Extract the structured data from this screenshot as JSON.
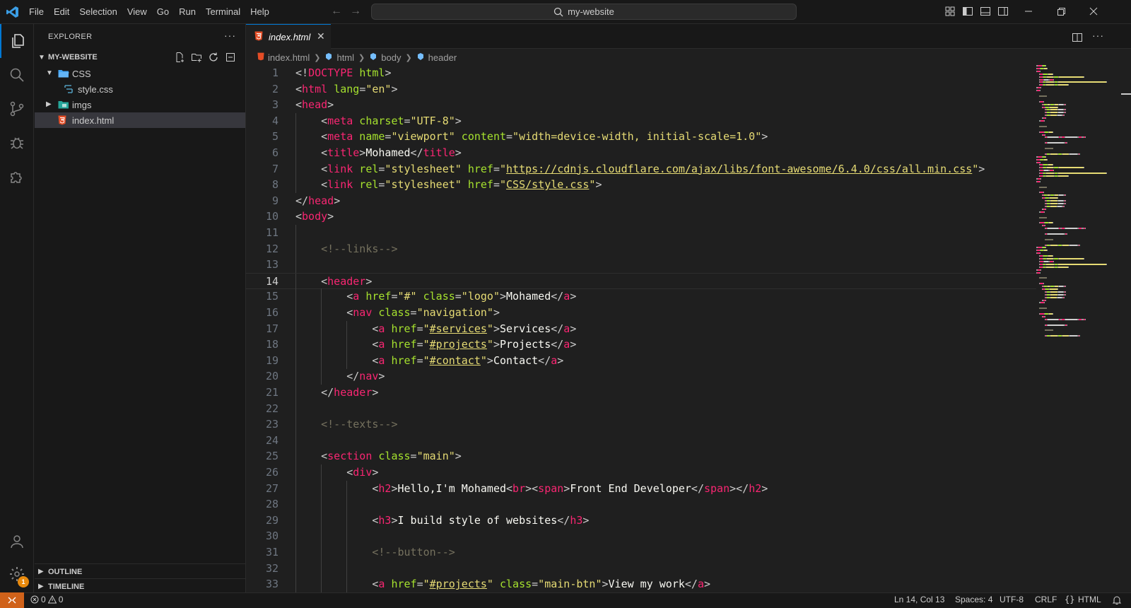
{
  "menu": [
    "File",
    "Edit",
    "Selection",
    "View",
    "Go",
    "Run",
    "Terminal",
    "Help"
  ],
  "search": {
    "text": "my-website"
  },
  "sidebar": {
    "title": "EXPLORER",
    "folder": "MY-WEBSITE",
    "tree": [
      {
        "label": "CSS",
        "kind": "folder-open",
        "depth": 1
      },
      {
        "label": "style.css",
        "kind": "css-file",
        "depth": 2
      },
      {
        "label": "imgs",
        "kind": "folder-closed",
        "depth": 1
      },
      {
        "label": "index.html",
        "kind": "html-file",
        "depth": 1,
        "selected": true
      }
    ],
    "sections": {
      "outline": "OUTLINE",
      "timeline": "TIMELINE"
    }
  },
  "editor": {
    "tab": "index.html",
    "breadcrumb": [
      "index.html",
      "html",
      "body",
      "header"
    ],
    "current_line": 14,
    "lines": [
      {
        "n": "1",
        "ind": 0,
        "toks": [
          [
            "p",
            "<!"
          ],
          [
            "t",
            "DOCTYPE"
          ],
          [
            "p",
            " "
          ],
          [
            "a",
            "html"
          ],
          [
            "p",
            ">"
          ]
        ]
      },
      {
        "n": "2",
        "ind": 0,
        "toks": [
          [
            "p",
            "<"
          ],
          [
            "t",
            "html"
          ],
          [
            "p",
            " "
          ],
          [
            "a",
            "lang"
          ],
          [
            "p",
            "="
          ],
          [
            "s",
            "\"en\""
          ],
          [
            "p",
            ">"
          ]
        ]
      },
      {
        "n": "3",
        "ind": 0,
        "toks": [
          [
            "p",
            "<"
          ],
          [
            "t",
            "head"
          ],
          [
            "p",
            ">"
          ]
        ]
      },
      {
        "n": "4",
        "ind": 1,
        "toks": [
          [
            "p",
            "<"
          ],
          [
            "t",
            "meta"
          ],
          [
            "p",
            " "
          ],
          [
            "a",
            "charset"
          ],
          [
            "p",
            "="
          ],
          [
            "s",
            "\"UTF-8\""
          ],
          [
            "p",
            ">"
          ]
        ]
      },
      {
        "n": "5",
        "ind": 1,
        "toks": [
          [
            "p",
            "<"
          ],
          [
            "t",
            "meta"
          ],
          [
            "p",
            " "
          ],
          [
            "a",
            "name"
          ],
          [
            "p",
            "="
          ],
          [
            "s",
            "\"viewport\""
          ],
          [
            "p",
            " "
          ],
          [
            "a",
            "content"
          ],
          [
            "p",
            "="
          ],
          [
            "s",
            "\"width=device-width, initial-scale=1.0\""
          ],
          [
            "p",
            ">"
          ]
        ]
      },
      {
        "n": "6",
        "ind": 1,
        "toks": [
          [
            "p",
            "<"
          ],
          [
            "t",
            "title"
          ],
          [
            "p",
            ">"
          ],
          [
            "x",
            "Mohamed"
          ],
          [
            "p",
            "</"
          ],
          [
            "t",
            "title"
          ],
          [
            "p",
            ">"
          ]
        ]
      },
      {
        "n": "7",
        "ind": 1,
        "toks": [
          [
            "p",
            "<"
          ],
          [
            "t",
            "link"
          ],
          [
            "p",
            " "
          ],
          [
            "a",
            "rel"
          ],
          [
            "p",
            "="
          ],
          [
            "s",
            "\"stylesheet\""
          ],
          [
            "p",
            " "
          ],
          [
            "a",
            "href"
          ],
          [
            "p",
            "="
          ],
          [
            "s",
            "\""
          ],
          [
            "u",
            "https://cdnjs.cloudflare.com/ajax/libs/font-awesome/6.4.0/css/all.min.css"
          ],
          [
            "s",
            "\""
          ],
          [
            "p",
            ">"
          ]
        ]
      },
      {
        "n": "8",
        "ind": 1,
        "toks": [
          [
            "p",
            "<"
          ],
          [
            "t",
            "link"
          ],
          [
            "p",
            " "
          ],
          [
            "a",
            "rel"
          ],
          [
            "p",
            "="
          ],
          [
            "s",
            "\"stylesheet\""
          ],
          [
            "p",
            " "
          ],
          [
            "a",
            "href"
          ],
          [
            "p",
            "="
          ],
          [
            "s",
            "\""
          ],
          [
            "u",
            "CSS/style.css"
          ],
          [
            "s",
            "\""
          ],
          [
            "p",
            ">"
          ]
        ]
      },
      {
        "n": "9",
        "ind": 0,
        "toks": [
          [
            "p",
            "</"
          ],
          [
            "t",
            "head"
          ],
          [
            "p",
            ">"
          ]
        ]
      },
      {
        "n": "10",
        "ind": 0,
        "toks": [
          [
            "p",
            "<"
          ],
          [
            "t",
            "body"
          ],
          [
            "p",
            ">"
          ]
        ]
      },
      {
        "n": "11",
        "ind": 1,
        "toks": []
      },
      {
        "n": "12",
        "ind": 1,
        "toks": [
          [
            "c",
            "<!--links-->"
          ]
        ]
      },
      {
        "n": "13",
        "ind": 1,
        "toks": []
      },
      {
        "n": "14",
        "ind": 1,
        "toks": [
          [
            "p",
            "<"
          ],
          [
            "t",
            "header"
          ],
          [
            "p",
            ">"
          ]
        ]
      },
      {
        "n": "15",
        "ind": 2,
        "toks": [
          [
            "p",
            "<"
          ],
          [
            "t",
            "a"
          ],
          [
            "p",
            " "
          ],
          [
            "a",
            "href"
          ],
          [
            "p",
            "="
          ],
          [
            "s",
            "\"#\""
          ],
          [
            "p",
            " "
          ],
          [
            "a",
            "class"
          ],
          [
            "p",
            "="
          ],
          [
            "s",
            "\"logo\""
          ],
          [
            "p",
            ">"
          ],
          [
            "x",
            "Mohamed"
          ],
          [
            "p",
            "</"
          ],
          [
            "t",
            "a"
          ],
          [
            "p",
            ">"
          ]
        ]
      },
      {
        "n": "16",
        "ind": 2,
        "toks": [
          [
            "p",
            "<"
          ],
          [
            "t",
            "nav"
          ],
          [
            "p",
            " "
          ],
          [
            "a",
            "class"
          ],
          [
            "p",
            "="
          ],
          [
            "s",
            "\"navigation\""
          ],
          [
            "p",
            ">"
          ]
        ]
      },
      {
        "n": "17",
        "ind": 3,
        "toks": [
          [
            "p",
            "<"
          ],
          [
            "t",
            "a"
          ],
          [
            "p",
            " "
          ],
          [
            "a",
            "href"
          ],
          [
            "p",
            "="
          ],
          [
            "s",
            "\""
          ],
          [
            "u",
            "#services"
          ],
          [
            "s",
            "\""
          ],
          [
            "p",
            ">"
          ],
          [
            "x",
            "Services"
          ],
          [
            "p",
            "</"
          ],
          [
            "t",
            "a"
          ],
          [
            "p",
            ">"
          ]
        ]
      },
      {
        "n": "18",
        "ind": 3,
        "toks": [
          [
            "p",
            "<"
          ],
          [
            "t",
            "a"
          ],
          [
            "p",
            " "
          ],
          [
            "a",
            "href"
          ],
          [
            "p",
            "="
          ],
          [
            "s",
            "\""
          ],
          [
            "u",
            "#projects"
          ],
          [
            "s",
            "\""
          ],
          [
            "p",
            ">"
          ],
          [
            "x",
            "Projects"
          ],
          [
            "p",
            "</"
          ],
          [
            "t",
            "a"
          ],
          [
            "p",
            ">"
          ]
        ]
      },
      {
        "n": "19",
        "ind": 3,
        "toks": [
          [
            "p",
            "<"
          ],
          [
            "t",
            "a"
          ],
          [
            "p",
            " "
          ],
          [
            "a",
            "href"
          ],
          [
            "p",
            "="
          ],
          [
            "s",
            "\""
          ],
          [
            "u",
            "#contact"
          ],
          [
            "s",
            "\""
          ],
          [
            "p",
            ">"
          ],
          [
            "x",
            "Contact"
          ],
          [
            "p",
            "</"
          ],
          [
            "t",
            "a"
          ],
          [
            "p",
            ">"
          ]
        ]
      },
      {
        "n": "20",
        "ind": 2,
        "toks": [
          [
            "p",
            "</"
          ],
          [
            "t",
            "nav"
          ],
          [
            "p",
            ">"
          ]
        ]
      },
      {
        "n": "21",
        "ind": 1,
        "toks": [
          [
            "p",
            "</"
          ],
          [
            "t",
            "header"
          ],
          [
            "p",
            ">"
          ]
        ]
      },
      {
        "n": "22",
        "ind": 1,
        "toks": []
      },
      {
        "n": "23",
        "ind": 1,
        "toks": [
          [
            "c",
            "<!--texts-->"
          ]
        ]
      },
      {
        "n": "24",
        "ind": 1,
        "toks": []
      },
      {
        "n": "25",
        "ind": 1,
        "toks": [
          [
            "p",
            "<"
          ],
          [
            "t",
            "section"
          ],
          [
            "p",
            " "
          ],
          [
            "a",
            "class"
          ],
          [
            "p",
            "="
          ],
          [
            "s",
            "\"main\""
          ],
          [
            "p",
            ">"
          ]
        ]
      },
      {
        "n": "26",
        "ind": 2,
        "toks": [
          [
            "p",
            "<"
          ],
          [
            "t",
            "div"
          ],
          [
            "p",
            ">"
          ]
        ]
      },
      {
        "n": "27",
        "ind": 3,
        "toks": [
          [
            "p",
            "<"
          ],
          [
            "t",
            "h2"
          ],
          [
            "p",
            ">"
          ],
          [
            "x",
            "Hello,I'm Mohamed"
          ],
          [
            "p",
            "<"
          ],
          [
            "t",
            "br"
          ],
          [
            "p",
            "><"
          ],
          [
            "t",
            "span"
          ],
          [
            "p",
            ">"
          ],
          [
            "x",
            "Front End Developer"
          ],
          [
            "p",
            "</"
          ],
          [
            "t",
            "span"
          ],
          [
            "p",
            "></"
          ],
          [
            "t",
            "h2"
          ],
          [
            "p",
            ">"
          ]
        ]
      },
      {
        "n": "28",
        "ind": 3,
        "toks": []
      },
      {
        "n": "29",
        "ind": 3,
        "toks": [
          [
            "p",
            "<"
          ],
          [
            "t",
            "h3"
          ],
          [
            "p",
            ">"
          ],
          [
            "x",
            "I build style of websites"
          ],
          [
            "p",
            "</"
          ],
          [
            "t",
            "h3"
          ],
          [
            "p",
            ">"
          ]
        ]
      },
      {
        "n": "30",
        "ind": 3,
        "toks": []
      },
      {
        "n": "31",
        "ind": 3,
        "toks": [
          [
            "c",
            "<!--button-->"
          ]
        ]
      },
      {
        "n": "32",
        "ind": 3,
        "toks": []
      },
      {
        "n": "33",
        "ind": 3,
        "toks": [
          [
            "p",
            "<"
          ],
          [
            "t",
            "a"
          ],
          [
            "p",
            " "
          ],
          [
            "a",
            "href"
          ],
          [
            "p",
            "="
          ],
          [
            "s",
            "\""
          ],
          [
            "u",
            "#projects"
          ],
          [
            "s",
            "\""
          ],
          [
            "p",
            " "
          ],
          [
            "a",
            "class"
          ],
          [
            "p",
            "="
          ],
          [
            "s",
            "\"main-btn\""
          ],
          [
            "p",
            ">"
          ],
          [
            "x",
            "View my work"
          ],
          [
            "p",
            "</"
          ],
          [
            "t",
            "a"
          ],
          [
            "p",
            ">"
          ]
        ]
      }
    ]
  },
  "status": {
    "errors": "0",
    "warnings": "0",
    "position": "Ln 14, Col 13",
    "spaces": "Spaces: 4",
    "encoding": "UTF-8",
    "eol": "CRLF",
    "language": "HTML"
  },
  "account_badge": "1",
  "colors": {
    "accent": "#0078d4",
    "remote": "#d0621a",
    "tag": "#f92672",
    "attribute": "#a6e22e",
    "string": "#e6db74",
    "comment": "#75715e",
    "html_icon": "#e44d26",
    "css_icon": "#519aba"
  }
}
